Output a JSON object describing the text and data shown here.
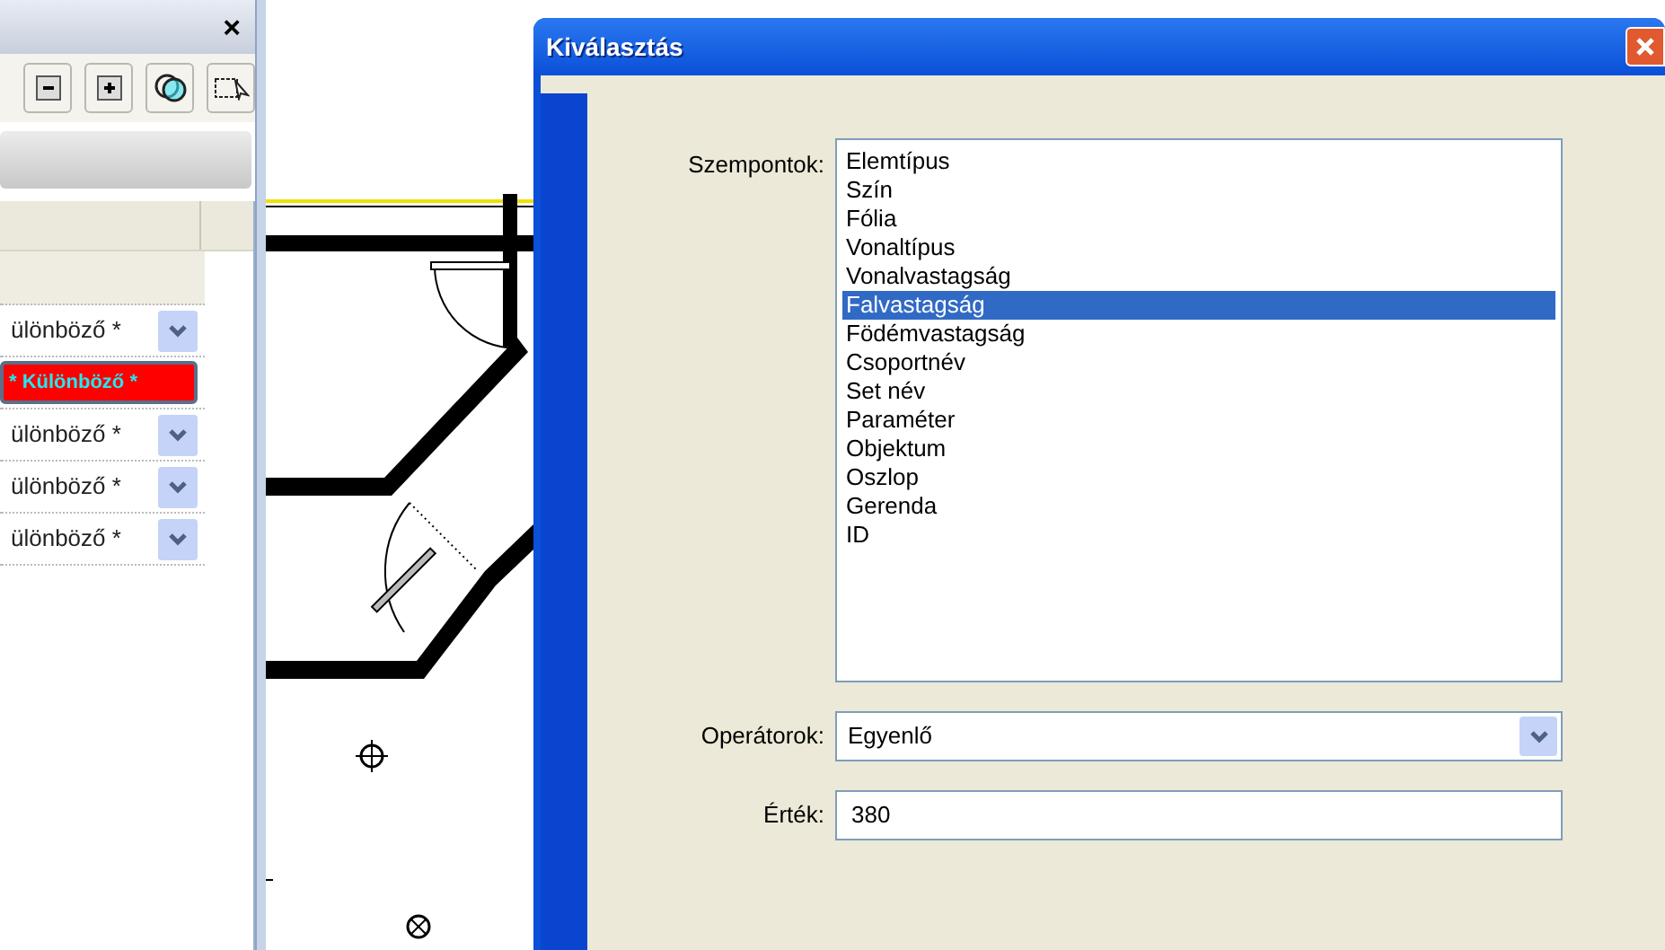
{
  "side_panel": {
    "close": "×",
    "properties": [
      {
        "kind": "dropdown",
        "value": "ülönböző *"
      },
      {
        "kind": "error",
        "value": "* Különböző *"
      },
      {
        "kind": "dropdown",
        "value": "ülönböző *"
      },
      {
        "kind": "dropdown",
        "value": "ülönböző *"
      },
      {
        "kind": "dropdown",
        "value": "ülönböző *"
      }
    ]
  },
  "dialog": {
    "title": "Kiválasztás",
    "criteria": {
      "label": "Szempontok:",
      "items": [
        {
          "label": "Elemtípus",
          "selected": false
        },
        {
          "label": "Szín",
          "selected": false
        },
        {
          "label": "Fólia",
          "selected": false
        },
        {
          "label": "Vonaltípus",
          "selected": false
        },
        {
          "label": "Vonalvastagság",
          "selected": false
        },
        {
          "label": "Falvastagság",
          "selected": true
        },
        {
          "label": "Födémvastagság",
          "selected": false
        },
        {
          "label": "Csoportnév",
          "selected": false
        },
        {
          "label": "Set név",
          "selected": false
        },
        {
          "label": "Paraméter",
          "selected": false
        },
        {
          "label": "Objektum",
          "selected": false
        },
        {
          "label": "Oszlop",
          "selected": false
        },
        {
          "label": "Gerenda",
          "selected": false
        },
        {
          "label": "ID",
          "selected": false
        }
      ]
    },
    "operators": {
      "label": "Operátorok:",
      "value": "Egyenlő"
    },
    "value_field": {
      "label": "Érték:",
      "value": "380"
    }
  }
}
